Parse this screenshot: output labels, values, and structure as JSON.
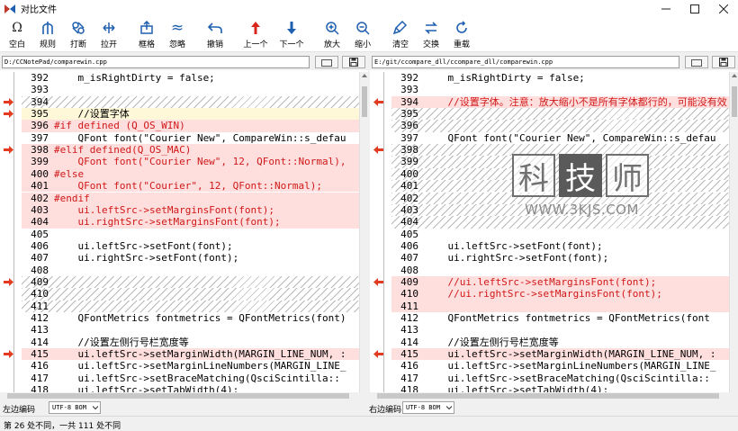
{
  "window": {
    "title": "对比文件"
  },
  "toolbar": {
    "buttons": [
      {
        "id": "blank",
        "label": "空白",
        "icon": "omega-icon"
      },
      {
        "id": "rules",
        "label": "规则",
        "icon": "rules-icon"
      },
      {
        "id": "break",
        "label": "打断",
        "icon": "break-icon"
      },
      {
        "id": "open",
        "label": "拉开",
        "icon": "spread-icon"
      },
      {
        "id": "collapse",
        "label": "框格",
        "icon": "frame-icon"
      },
      {
        "id": "ignore",
        "label": "忽略",
        "icon": "wave-icon"
      },
      {
        "id": "undo",
        "label": "撤销",
        "icon": "undo-icon"
      },
      {
        "id": "prev",
        "label": "上一个",
        "icon": "arrow-up-icon"
      },
      {
        "id": "next",
        "label": "下一个",
        "icon": "arrow-down-icon"
      },
      {
        "id": "zoomin",
        "label": "放大",
        "icon": "zoom-in-icon"
      },
      {
        "id": "zoomout",
        "label": "缩小",
        "icon": "zoom-out-icon"
      },
      {
        "id": "clear",
        "label": "清空",
        "icon": "clear-icon"
      },
      {
        "id": "swap",
        "label": "交换",
        "icon": "swap-icon"
      },
      {
        "id": "reload",
        "label": "重载",
        "icon": "reload-icon"
      }
    ]
  },
  "left": {
    "path": "D:/CCNotePad/comparewin.cpp",
    "encoding_label": "左边编码",
    "encoding": "UTF-8 BOM",
    "rows": [
      {
        "ln": "392",
        "text": "    m_isRightDirty = false;",
        "kind": "",
        "mark": false
      },
      {
        "ln": "393",
        "text": "",
        "kind": "",
        "mark": false
      },
      {
        "ln": "394",
        "text": "",
        "kind": "hatch",
        "mark": true
      },
      {
        "ln": "395",
        "text": "    //设置字体",
        "kind": "mod",
        "mark": true
      },
      {
        "ln": "396",
        "text": "#if defined (Q_OS_WIN)",
        "kind": "del",
        "mark": false,
        "color": "red"
      },
      {
        "ln": "397",
        "text": "    QFont font(\"Courier New\", CompareWin::s_defau",
        "kind": "",
        "mark": false
      },
      {
        "ln": "398",
        "text": "#elif defined(Q_OS_MAC)",
        "kind": "del",
        "mark": true,
        "color": "red"
      },
      {
        "ln": "399",
        "text": "    QFont font(\"Courier New\", 12, QFont::Normal),",
        "kind": "del",
        "mark": false,
        "color": "red"
      },
      {
        "ln": "400",
        "text": "#else",
        "kind": "del",
        "mark": false,
        "color": "red"
      },
      {
        "ln": "401",
        "text": "    QFont font(\"Courier\", 12, QFont::Normal);",
        "kind": "del",
        "mark": false,
        "color": "red"
      },
      {
        "ln": "402",
        "text": "#endif",
        "kind": "del",
        "mark": false,
        "color": "red"
      },
      {
        "ln": "403",
        "text": "    ui.leftSrc->setMarginsFont(font);",
        "kind": "del",
        "mark": false,
        "color": "red"
      },
      {
        "ln": "404",
        "text": "    ui.rightSrc->setMarginsFont(font);",
        "kind": "del",
        "mark": false,
        "color": "red"
      },
      {
        "ln": "405",
        "text": "",
        "kind": "",
        "mark": false
      },
      {
        "ln": "406",
        "text": "    ui.leftSrc->setFont(font);",
        "kind": "",
        "mark": false
      },
      {
        "ln": "407",
        "text": "    ui.rightSrc->setFont(font);",
        "kind": "",
        "mark": false
      },
      {
        "ln": "408",
        "text": "",
        "kind": "",
        "mark": false
      },
      {
        "ln": "409",
        "text": "",
        "kind": "hatch",
        "mark": true
      },
      {
        "ln": "410",
        "text": "",
        "kind": "hatch",
        "mark": false
      },
      {
        "ln": "411",
        "text": "",
        "kind": "hatch",
        "mark": false
      },
      {
        "ln": "412",
        "text": "    QFontMetrics fontmetrics = QFontMetrics(font)",
        "kind": "",
        "mark": false
      },
      {
        "ln": "413",
        "text": "",
        "kind": "",
        "mark": false
      },
      {
        "ln": "414",
        "text": "    //设置左侧行号栏宽度等",
        "kind": "",
        "mark": false
      },
      {
        "ln": "415",
        "text": "    ui.leftSrc->setMarginWidth(MARGIN_LINE_NUM, :",
        "kind": "del",
        "mark": true
      },
      {
        "ln": "416",
        "text": "    ui.leftSrc->setMarginLineNumbers(MARGIN_LINE_",
        "kind": "",
        "mark": false
      },
      {
        "ln": "417",
        "text": "    ui.leftSrc->setBraceMatching(QsciScintilla::",
        "kind": "",
        "mark": false
      },
      {
        "ln": "418",
        "text": "    ui.leftSrc->setTabWidth(4);",
        "kind": "",
        "mark": false
      }
    ]
  },
  "right": {
    "path": "E:/git/ccompare_dll/ccompare_dll/comparewin.cpp",
    "encoding_label": "右边编码",
    "encoding": "UTF-8 BOM",
    "rows": [
      {
        "ln": "392",
        "text": "    m_isRightDirty = false;",
        "kind": "",
        "mark": false
      },
      {
        "ln": "393",
        "text": "",
        "kind": "",
        "mark": false
      },
      {
        "ln": "394",
        "text": "    //设置字体。注意：放大缩小不是所有字体都行的，可能没有效",
        "kind": "del",
        "mark": true,
        "color": "red"
      },
      {
        "ln": "395",
        "text": "",
        "kind": "hatch",
        "mark": false
      },
      {
        "ln": "396",
        "text": "",
        "kind": "hatch",
        "mark": false
      },
      {
        "ln": "397",
        "text": "    QFont font(\"Courier New\", CompareWin::s_defau",
        "kind": "",
        "mark": false
      },
      {
        "ln": "398",
        "text": "",
        "kind": "hatch",
        "mark": true
      },
      {
        "ln": "399",
        "text": "",
        "kind": "hatch",
        "mark": false
      },
      {
        "ln": "400",
        "text": "",
        "kind": "hatch",
        "mark": false
      },
      {
        "ln": "401",
        "text": "",
        "kind": "hatch",
        "mark": false
      },
      {
        "ln": "402",
        "text": "",
        "kind": "hatch",
        "mark": false
      },
      {
        "ln": "403",
        "text": "",
        "kind": "hatch",
        "mark": false
      },
      {
        "ln": "404",
        "text": "",
        "kind": "hatch",
        "mark": false
      },
      {
        "ln": "405",
        "text": "",
        "kind": "",
        "mark": false
      },
      {
        "ln": "406",
        "text": "    ui.leftSrc->setFont(font);",
        "kind": "",
        "mark": false
      },
      {
        "ln": "407",
        "text": "    ui.rightSrc->setFont(font);",
        "kind": "",
        "mark": false
      },
      {
        "ln": "408",
        "text": "",
        "kind": "",
        "mark": false
      },
      {
        "ln": "409",
        "text": "    //ui.leftSrc->setMarginsFont(font);",
        "kind": "del",
        "mark": true,
        "color": "red"
      },
      {
        "ln": "410",
        "text": "    //ui.rightSrc->setMarginsFont(font);",
        "kind": "del",
        "mark": false,
        "color": "red"
      },
      {
        "ln": "411",
        "text": "",
        "kind": "del",
        "mark": false
      },
      {
        "ln": "412",
        "text": "    QFontMetrics fontmetrics = QFontMetrics(font",
        "kind": "",
        "mark": false
      },
      {
        "ln": "413",
        "text": "",
        "kind": "",
        "mark": false
      },
      {
        "ln": "414",
        "text": "    //设置左侧行号栏宽度等",
        "kind": "",
        "mark": false
      },
      {
        "ln": "415",
        "text": "    ui.leftSrc->setMarginWidth(MARGIN_LINE_NUM, :",
        "kind": "del",
        "mark": true
      },
      {
        "ln": "416",
        "text": "    ui.leftSrc->setMarginLineNumbers(MARGIN_LINE_",
        "kind": "",
        "mark": false
      },
      {
        "ln": "417",
        "text": "    ui.leftSrc->setBraceMatching(QsciScintilla::",
        "kind": "",
        "mark": false
      },
      {
        "ln": "418",
        "text": "    ui.leftSrc->setTabWidth(4);",
        "kind": "",
        "mark": false
      }
    ]
  },
  "status": {
    "text": "第 26 处不同，一共 111 处不同"
  },
  "watermark": {
    "chars": [
      "科",
      "技",
      "师"
    ],
    "url": "WWW.3KJS.COM"
  },
  "colors": {
    "accent": "#1f5fb0",
    "diff_mark": "#e23b1f",
    "diff_bg": "#ffdede",
    "modified_bg": "#fff8d8"
  }
}
